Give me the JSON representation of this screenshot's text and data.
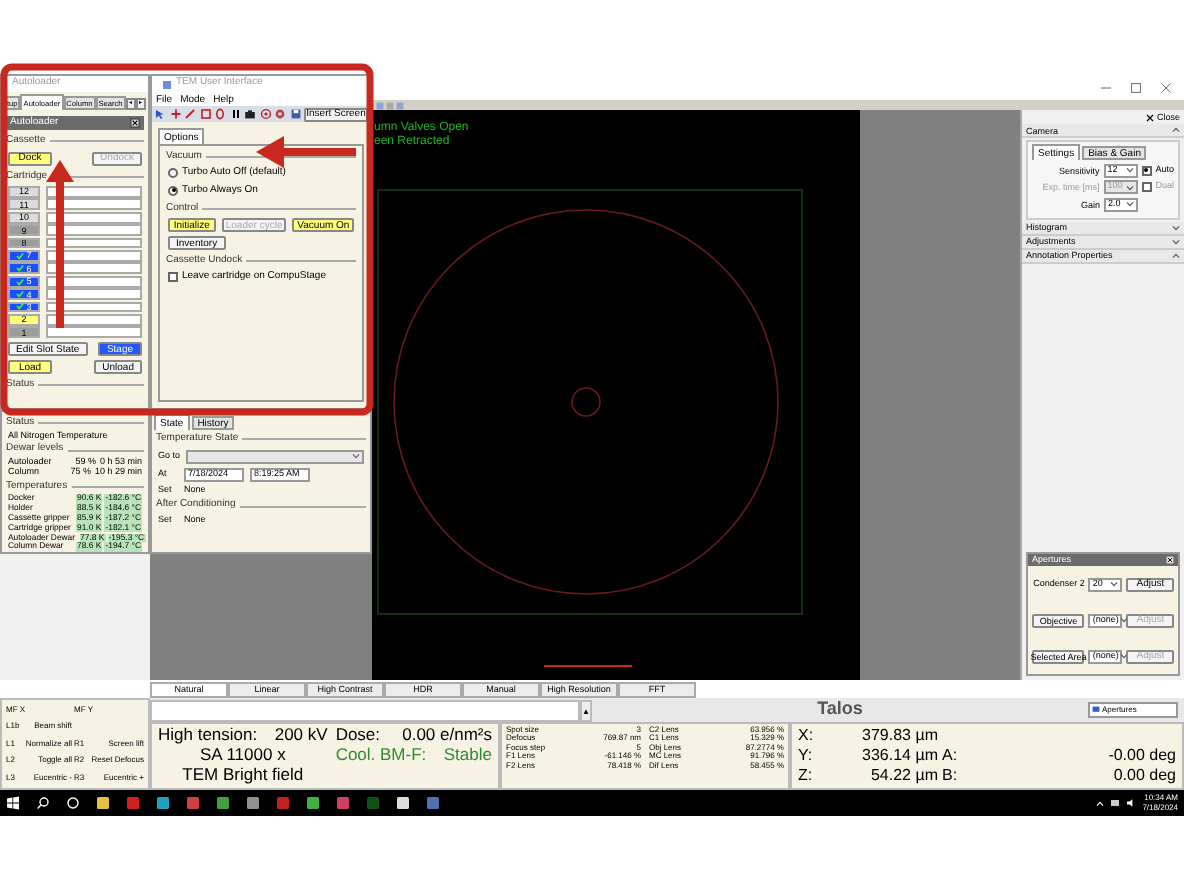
{
  "autoloader_window": {
    "title": "Autoloader",
    "tabs": [
      {
        "label": "tup",
        "selected": false
      },
      {
        "label": "Autoloader",
        "selected": true
      },
      {
        "label": "Column",
        "selected": false
      },
      {
        "label": "Search",
        "selected": false
      }
    ],
    "tab_scroll": [
      "◂",
      "▸"
    ],
    "panel_title": "Autoloader",
    "cassette": {
      "label": "Cassette",
      "buttons": [
        {
          "label": "Dock",
          "kind": "highlight",
          "disabled": false
        },
        {
          "label": "Undock",
          "kind": "plain",
          "disabled": true
        }
      ]
    },
    "cartridge": {
      "label": "Cartridge",
      "slots": [
        {
          "label": "12",
          "color": "#dcdcdc",
          "checked": false
        },
        {
          "label": "11",
          "color": "#dcdcdc",
          "checked": false
        },
        {
          "label": "10",
          "color": "#dcdcdc",
          "checked": false
        },
        {
          "label": "9",
          "color": "#9c9c9c",
          "checked": false
        },
        {
          "label": "8",
          "color": "#9c9c9c",
          "checked": false
        },
        {
          "label": "7",
          "color": "#1d4fff",
          "checked": true
        },
        {
          "label": "6",
          "color": "#1d4fff",
          "checked": true
        },
        {
          "label": "5",
          "color": "#1d4fff",
          "checked": true
        },
        {
          "label": "4",
          "color": "#1d4fff",
          "checked": true
        },
        {
          "label": "3",
          "color": "#1d4fff",
          "checked": true
        },
        {
          "label": "2",
          "color": "#ffff7a",
          "checked": false
        },
        {
          "label": "1",
          "color": "#9c9c9c",
          "checked": false
        }
      ]
    },
    "buttons": [
      {
        "label": "Edit Slot State",
        "kind": "plain",
        "disabled": false
      },
      {
        "label": "Stage",
        "kind": "active",
        "disabled": false
      },
      {
        "label": "Load",
        "kind": "highlight",
        "disabled": false
      },
      {
        "label": "Unload",
        "kind": "plain",
        "disabled": false
      }
    ],
    "status_label": "Status"
  },
  "options_window": {
    "title": "TEM User Interface",
    "menu": [
      "File",
      "Mode",
      "Help"
    ],
    "insert_screen": "Insert Screen",
    "tab": "Options",
    "vacuum": {
      "label": "Vacuum",
      "options": [
        {
          "label": "Turbo Auto Off (default)",
          "selected": false
        },
        {
          "label": "Turbo Always On",
          "selected": true
        }
      ]
    },
    "control": {
      "label": "Control",
      "buttons": [
        {
          "label": "Initialize",
          "kind": "highlight",
          "disabled": false
        },
        {
          "label": "Loader cycle",
          "kind": "plain",
          "disabled": true
        },
        {
          "label": "Vacuum On",
          "kind": "highlight",
          "disabled": false
        },
        {
          "label": "Inventory",
          "kind": "plain",
          "disabled": false
        }
      ]
    },
    "undock": {
      "label": "Cassette Undock",
      "checkbox": {
        "label": "Leave cartridge on CompuStage",
        "checked": false
      }
    }
  },
  "status_panel": {
    "status_label": "Status",
    "status_text": "All Nitrogen Temperature",
    "dewar_label": "Dewar levels",
    "dewars": [
      {
        "name": "Autoloader",
        "percent": "59 %",
        "time": "0 h 53 min"
      },
      {
        "name": "Column",
        "percent": "75 %",
        "time": "10 h 29 min"
      }
    ],
    "temps_label": "Temperatures",
    "temps": [
      {
        "name": "Docker",
        "kelvin": "90.6 K",
        "celsius": "-182.6 °C"
      },
      {
        "name": "Holder",
        "kelvin": "88.5 K",
        "celsius": "-184.6 °C"
      },
      {
        "name": "Cassette gripper",
        "kelvin": "85.9 K",
        "celsius": "-187.2 °C"
      },
      {
        "name": "Cartridge gripper",
        "kelvin": "91.0 K",
        "celsius": "-182.1 °C"
      },
      {
        "name": "Autoloader Dewar",
        "kelvin": "77.8 K",
        "celsius": "-195.3 °C"
      },
      {
        "name": "Column Dewar",
        "kelvin": "78.6 K",
        "celsius": "-194.7 °C"
      }
    ]
  },
  "temperature_panel": {
    "tabs": [
      {
        "label": "State",
        "selected": true
      },
      {
        "label": "History",
        "selected": false
      }
    ],
    "state_label": "Temperature State",
    "goto_label": "Go to",
    "at_label": "At",
    "date": "7/18/2024",
    "time": "8:19:25 AM",
    "set_label": "Set",
    "set_value": "None",
    "after_label": "After Conditioning",
    "after_set_label": "Set",
    "after_set_value": "None"
  },
  "image": {
    "overlay_lines": [
      "umn Valves Open",
      "een Retracted"
    ]
  },
  "right_panel": {
    "close": "Close",
    "camera": {
      "title": "Camera",
      "expanded": true,
      "tabs": [
        {
          "label": "Settings",
          "selected": true
        },
        {
          "label": "Bias & Gain",
          "selected": false
        }
      ],
      "sensitivity": {
        "label": "Sensitivity",
        "value": "12"
      },
      "auto": {
        "label": "Auto",
        "checked": true
      },
      "exposure": {
        "label": "Exp. time [ms]",
        "value": "100",
        "disabled": true
      },
      "dual": {
        "label": "Dual",
        "checked": false
      },
      "gain": {
        "label": "Gain",
        "value": "2.0"
      }
    },
    "sections": [
      {
        "label": "Histogram",
        "expanded": false
      },
      {
        "label": "Adjustments",
        "expanded": false
      },
      {
        "label": "Annotation Properties",
        "expanded": true
      }
    ],
    "apertures": {
      "title": "Apertures",
      "rows": [
        {
          "label": "Condenser 2",
          "kind": "text",
          "value": "20",
          "button": "Adjust",
          "disabled": false
        },
        {
          "label": "Objective",
          "kind": "button",
          "value": "(none)",
          "button": "Adjust",
          "disabled": true
        },
        {
          "label": "Selected Area",
          "kind": "button",
          "value": "(none)",
          "button": "Adjust",
          "disabled": true
        }
      ]
    }
  },
  "image_modes": [
    {
      "label": "Natural",
      "selected": true
    },
    {
      "label": "Linear",
      "selected": false
    },
    {
      "label": "High Contrast",
      "selected": false
    },
    {
      "label": "HDR",
      "selected": false
    },
    {
      "label": "Manual",
      "selected": false
    },
    {
      "label": "High Resolution",
      "selected": false
    },
    {
      "label": "FFT",
      "selected": false
    }
  ],
  "mf_panel": {
    "rows": [
      {
        "cells": [
          {
            "key": "MF X"
          },
          {
            "key": "MF Y"
          }
        ]
      },
      {
        "cells": [
          {
            "key": "L1b",
            "label": "Beam shift"
          }
        ]
      },
      {
        "cells": [
          {
            "key": "L1",
            "label": "Normalize all"
          },
          {
            "key": "R1",
            "label": "Screen lift"
          }
        ]
      },
      {
        "cells": [
          {
            "key": "L2",
            "label": "Toggle all"
          },
          {
            "key": "R2",
            "label": "Reset Defocus"
          }
        ]
      },
      {
        "cells": [
          {
            "key": "L3",
            "label": "Eucentric -"
          },
          {
            "key": "R3",
            "label": "Eucentric +"
          }
        ]
      }
    ]
  },
  "command_bar": {
    "scroll": "▲"
  },
  "title_bar": {
    "title": "Talos",
    "dropdown": "Apertures"
  },
  "main_status": {
    "high_tension_label": "High tension:",
    "high_tension": "200 kV",
    "dose_label": "Dose:",
    "dose": "0.00 e/nm²s",
    "magnification": "SA 11000 x",
    "cooling_label": "Cool. BM-F:",
    "cooling": "Stable",
    "mode": "TEM Bright field"
  },
  "optics_left": [
    {
      "name": "Spot size",
      "value": "3"
    },
    {
      "name": "Defocus",
      "value": "769.87 nm"
    },
    {
      "name": "Focus step",
      "value": "5"
    },
    {
      "name": "F1 Lens",
      "value": "-61.146 %"
    },
    {
      "name": "F2 Lens",
      "value": "78.418 %"
    }
  ],
  "optics_right": [
    {
      "name": "C2 Lens",
      "value": "63.956 %"
    },
    {
      "name": "C1 Lens",
      "value": "15.329 %"
    },
    {
      "name": "Obj Lens",
      "value": "87.2774 %"
    },
    {
      "name": "MC Lens",
      "value": "91.796 %"
    },
    {
      "name": "Dif Lens",
      "value": "58.455 %"
    }
  ],
  "stage": [
    {
      "label": "X:",
      "value": "379.83 µm"
    },
    {
      "label": "Y:",
      "value": "336.14 µm"
    },
    {
      "label": "Z:",
      "value": "54.22 µm"
    }
  ],
  "tilt": [
    {
      "label": "A:",
      "value": "-0.00 deg"
    },
    {
      "label": "B:",
      "value": "0.00 deg"
    }
  ],
  "clock": {
    "time": "10:34 AM",
    "date": "7/18/2024"
  }
}
